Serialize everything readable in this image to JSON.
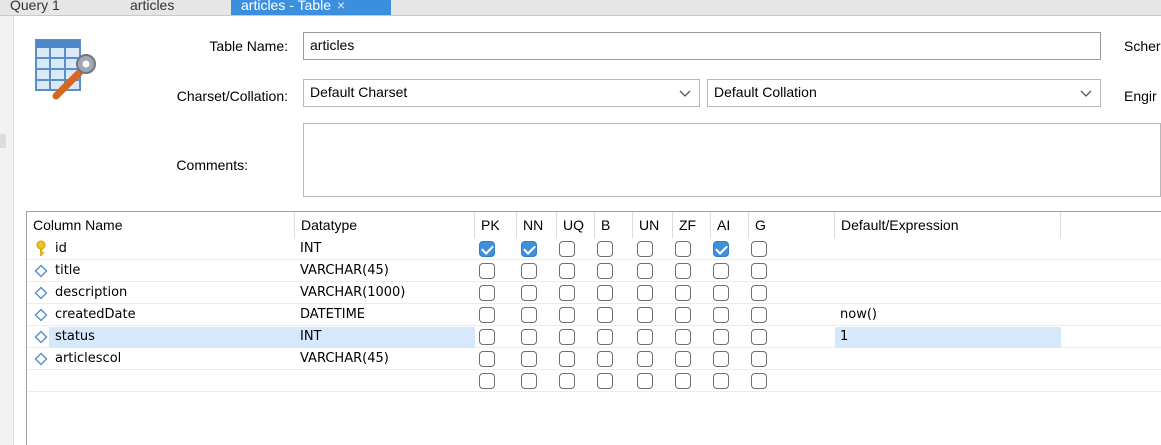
{
  "tabs": [
    {
      "label": "Query 1"
    },
    {
      "label": "articles"
    },
    {
      "label": "articles - Table",
      "close": "×"
    }
  ],
  "form": {
    "table_name_label": "Table Name:",
    "table_name_value": "articles",
    "charset_label": "Charset/Collation:",
    "charset_value": "Default Charset",
    "collation_value": "Default Collation",
    "comments_label": "Comments:",
    "comments_value": "",
    "schema_label": "Scher",
    "engine_label": "Engir",
    "chevron": "⌵"
  },
  "columns": {
    "headers": [
      "Column Name",
      "Datatype",
      "PK",
      "NN",
      "UQ",
      "B",
      "UN",
      "ZF",
      "AI",
      "G",
      "Default/Expression"
    ],
    "rows": [
      {
        "name": "id",
        "type": "INT",
        "key": true,
        "flags": [
          1,
          1,
          0,
          0,
          0,
          0,
          1,
          0
        ],
        "default": "",
        "selected": false
      },
      {
        "name": "title",
        "type": "VARCHAR(45)",
        "key": false,
        "flags": [
          0,
          0,
          0,
          0,
          0,
          0,
          0,
          0
        ],
        "default": "",
        "selected": false
      },
      {
        "name": "description",
        "type": "VARCHAR(1000)",
        "key": false,
        "flags": [
          0,
          0,
          0,
          0,
          0,
          0,
          0,
          0
        ],
        "default": "",
        "selected": false
      },
      {
        "name": "createdDate",
        "type": "DATETIME",
        "key": false,
        "flags": [
          0,
          0,
          0,
          0,
          0,
          0,
          0,
          0
        ],
        "default": "now()",
        "selected": false
      },
      {
        "name": "status",
        "type": "INT",
        "key": false,
        "flags": [
          0,
          0,
          0,
          0,
          0,
          0,
          0,
          0
        ],
        "default": "1",
        "selected": true
      },
      {
        "name": "articlescol",
        "type": "VARCHAR(45)",
        "key": false,
        "flags": [
          0,
          0,
          0,
          0,
          0,
          0,
          0,
          0
        ],
        "default": "",
        "selected": false
      },
      {
        "name": "",
        "type": "",
        "key": null,
        "flags": [
          0,
          0,
          0,
          0,
          0,
          0,
          0,
          0
        ],
        "default": "",
        "selected": false
      }
    ]
  },
  "colors": {
    "accent": "#3c8fde",
    "selection": "#d6e8fb",
    "checked": "#3f8fdc",
    "key_icon": "#f0c419"
  }
}
